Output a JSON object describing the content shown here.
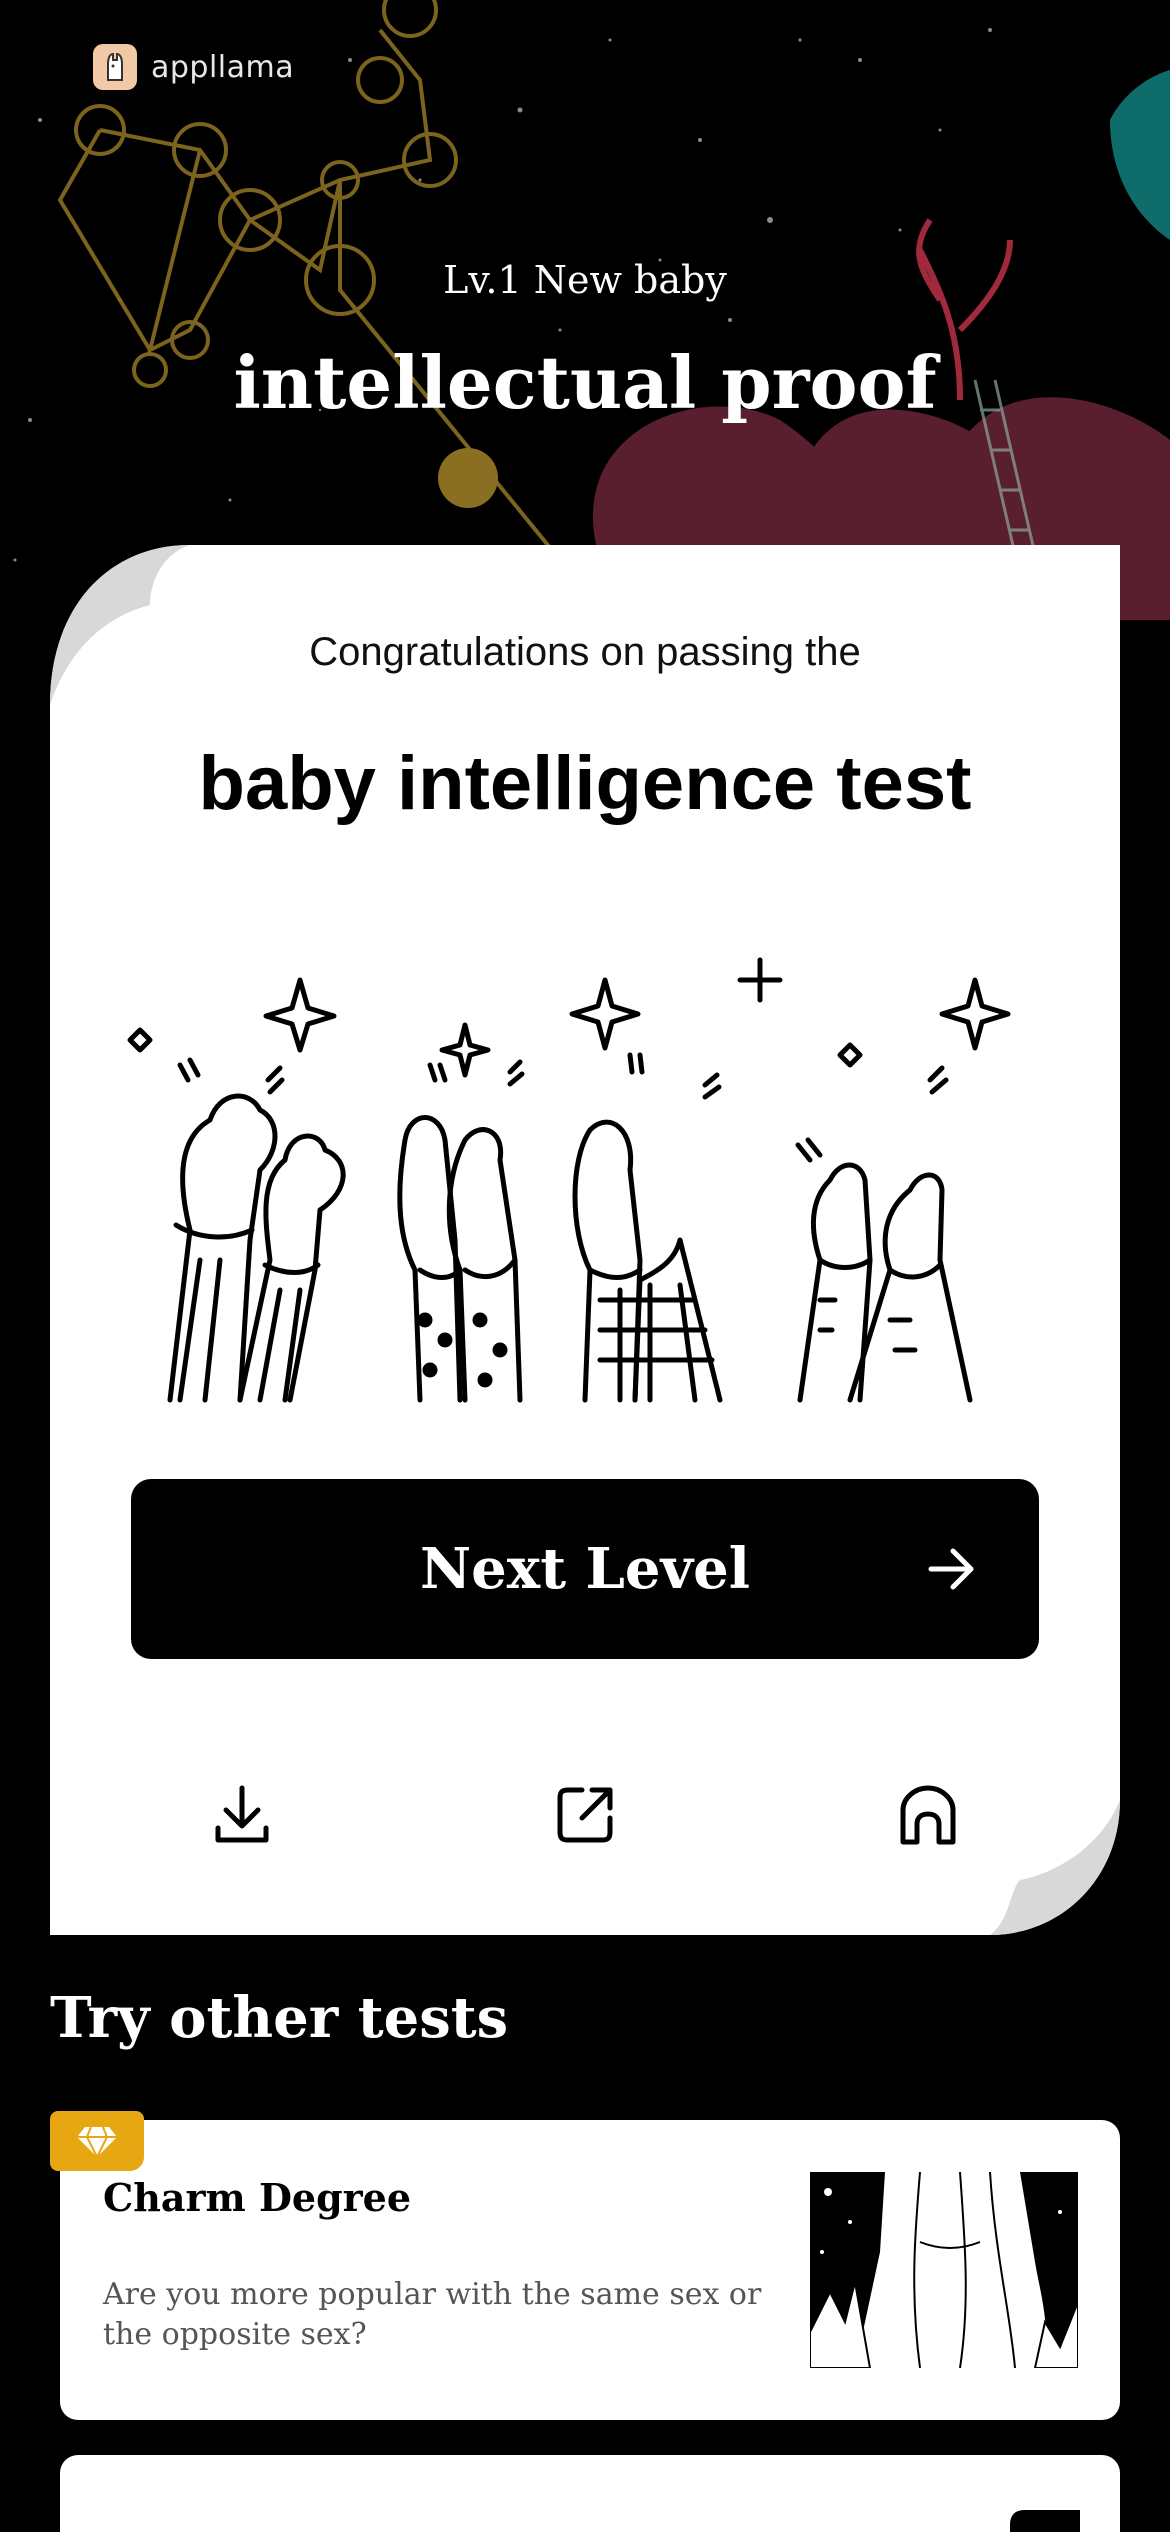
{
  "app": {
    "brand": "appllama"
  },
  "hero": {
    "level_subtitle": "Lv.1 New baby",
    "level_title": "intellectual proof"
  },
  "result_card": {
    "congrats_line": "Congratulations on passing the",
    "test_name": "baby intelligence test",
    "next_button_label": "Next Level",
    "actions": [
      {
        "name": "download",
        "icon": "download-icon"
      },
      {
        "name": "share",
        "icon": "share-icon"
      },
      {
        "name": "home",
        "icon": "home-icon"
      }
    ]
  },
  "other_tests": {
    "heading": "Try other tests",
    "items": [
      {
        "title": "Charm Degree",
        "description": "Are you more popular with the same sex or the opposite sex?",
        "badge_icon": "diamond-icon"
      }
    ]
  },
  "colors": {
    "background": "#000000",
    "card": "#ffffff",
    "premium_badge": "#e7a712",
    "constellation": "#8a6f22",
    "leaf": "#5a1f2e"
  }
}
